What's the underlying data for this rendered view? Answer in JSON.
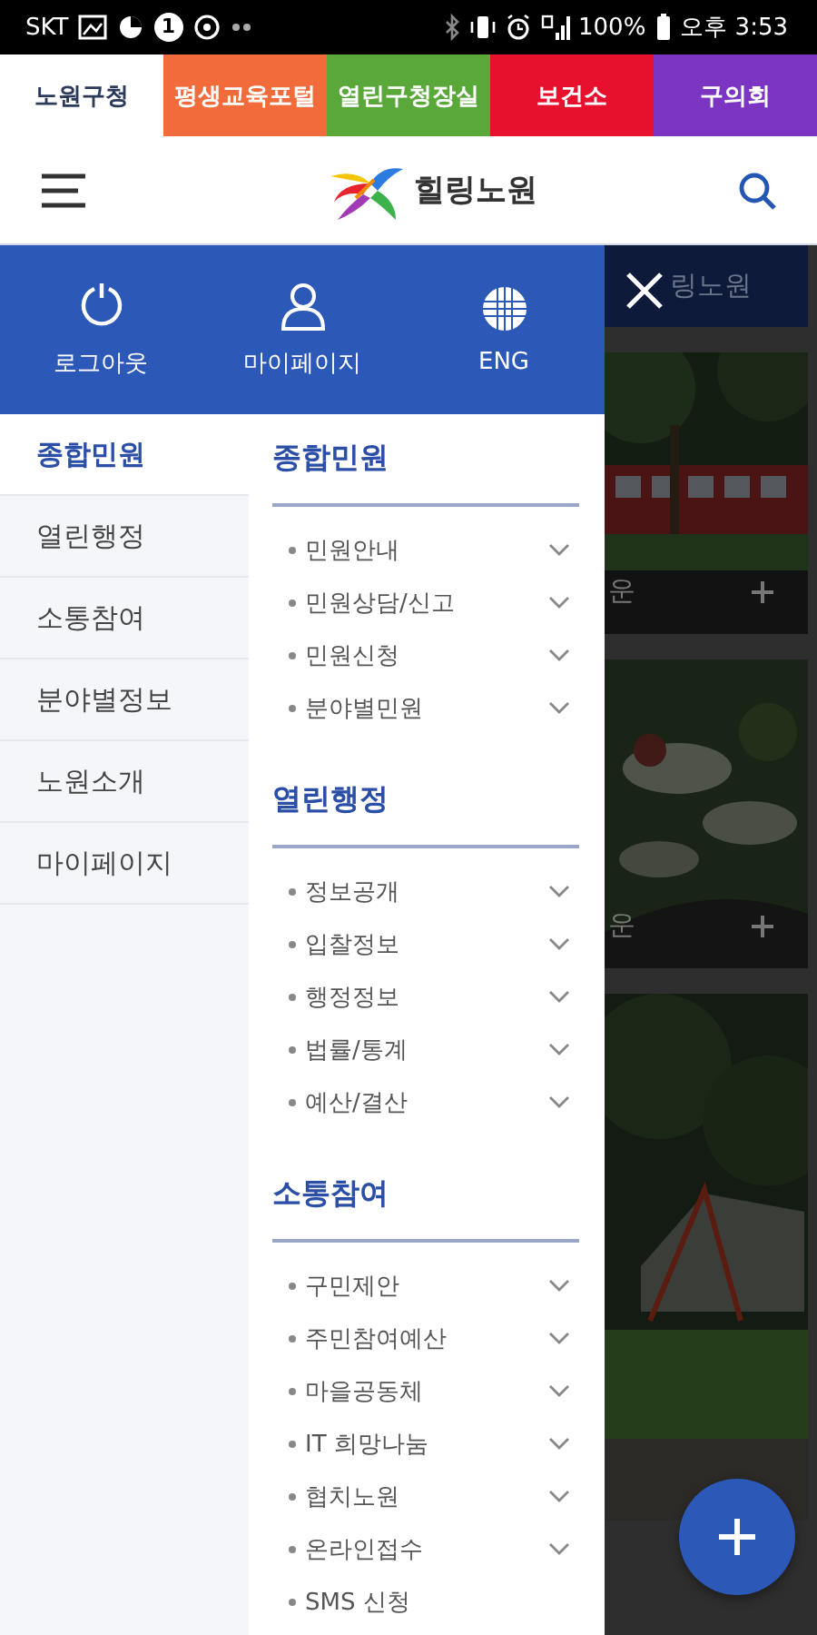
{
  "status_bar": {
    "carrier": "SKT",
    "badge": "1",
    "battery": "100%",
    "time": "오후 3:53"
  },
  "site_tabs": [
    {
      "label": "노원구청",
      "color": "#ffffff",
      "selected": true
    },
    {
      "label": "평생교육포털",
      "color": "#f26b3a",
      "selected": false
    },
    {
      "label": "열린구청장실",
      "color": "#5aa83a",
      "selected": false
    },
    {
      "label": "보건소",
      "color": "#e8112d",
      "selected": false
    },
    {
      "label": "구의회",
      "color": "#7b35c2",
      "selected": false
    }
  ],
  "header": {
    "logo_text": "힐링노원"
  },
  "drawer": {
    "quick_links": [
      {
        "kind": "power",
        "label": "로그아웃"
      },
      {
        "kind": "person",
        "label": "마이페이지"
      },
      {
        "kind": "globe",
        "label": "ENG"
      }
    ],
    "categories": [
      {
        "label": "종합민원",
        "selected": true
      },
      {
        "label": "열린행정",
        "selected": false
      },
      {
        "label": "소통참여",
        "selected": false
      },
      {
        "label": "분야별정보",
        "selected": false
      },
      {
        "label": "노원소개",
        "selected": false
      },
      {
        "label": "마이페이지",
        "selected": false
      }
    ],
    "sections": [
      {
        "title": "종합민원",
        "items": [
          {
            "label": "민원안내",
            "expandable": true
          },
          {
            "label": "민원상담/신고",
            "expandable": true
          },
          {
            "label": "민원신청",
            "expandable": true
          },
          {
            "label": "분야별민원",
            "expandable": true
          }
        ]
      },
      {
        "title": "열린행정",
        "items": [
          {
            "label": "정보공개",
            "expandable": true
          },
          {
            "label": "입찰정보",
            "expandable": true
          },
          {
            "label": "행정정보",
            "expandable": true
          },
          {
            "label": "법률/통계",
            "expandable": true
          },
          {
            "label": "예산/결산",
            "expandable": true
          }
        ]
      },
      {
        "title": "소통참여",
        "items": [
          {
            "label": "구민제안",
            "expandable": true
          },
          {
            "label": "주민참여예산",
            "expandable": true
          },
          {
            "label": "마을공동체",
            "expandable": true
          },
          {
            "label": "IT 희망나눔",
            "expandable": true
          },
          {
            "label": "협치노원",
            "expandable": true
          },
          {
            "label": "온라인접수",
            "expandable": true
          },
          {
            "label": "SMS 신청",
            "expandable": false
          }
        ]
      }
    ]
  },
  "background": {
    "banner_text": "링노원",
    "cards": [
      {
        "kind": "picture",
        "caption": "운"
      },
      {
        "kind": "picture",
        "caption": "운"
      },
      {
        "kind": "picture"
      }
    ]
  }
}
